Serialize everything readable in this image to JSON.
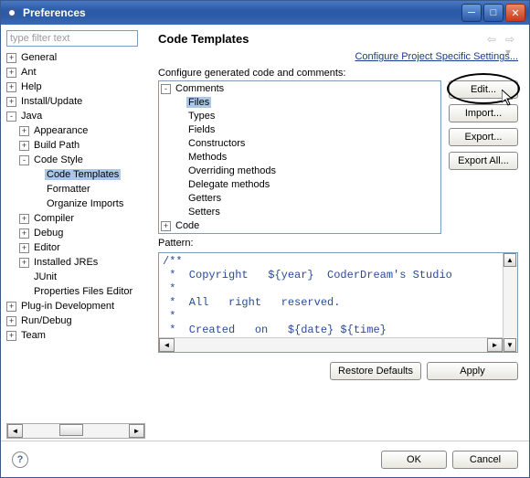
{
  "window": {
    "title": "Preferences"
  },
  "sidebar": {
    "filter_text": "type filter text",
    "tree": [
      {
        "label": "General",
        "tw": "+",
        "depth": 0
      },
      {
        "label": "Ant",
        "tw": "+",
        "depth": 0
      },
      {
        "label": "Help",
        "tw": "+",
        "depth": 0
      },
      {
        "label": "Install/Update",
        "tw": "+",
        "depth": 0
      },
      {
        "label": "Java",
        "tw": "-",
        "depth": 0
      },
      {
        "label": "Appearance",
        "tw": "+",
        "depth": 1
      },
      {
        "label": "Build Path",
        "tw": "+",
        "depth": 1
      },
      {
        "label": "Code Style",
        "tw": "-",
        "depth": 1
      },
      {
        "label": "Code Templates",
        "tw": "",
        "depth": 2,
        "selected": true
      },
      {
        "label": "Formatter",
        "tw": "",
        "depth": 2
      },
      {
        "label": "Organize Imports",
        "tw": "",
        "depth": 2
      },
      {
        "label": "Compiler",
        "tw": "+",
        "depth": 1
      },
      {
        "label": "Debug",
        "tw": "+",
        "depth": 1
      },
      {
        "label": "Editor",
        "tw": "+",
        "depth": 1
      },
      {
        "label": "Installed JREs",
        "tw": "+",
        "depth": 1
      },
      {
        "label": "JUnit",
        "tw": "",
        "depth": 1
      },
      {
        "label": "Properties Files Editor",
        "tw": "",
        "depth": 1
      },
      {
        "label": "Plug-in Development",
        "tw": "+",
        "depth": 0
      },
      {
        "label": "Run/Debug",
        "tw": "+",
        "depth": 0
      },
      {
        "label": "Team",
        "tw": "+",
        "depth": 0
      }
    ]
  },
  "main": {
    "title": "Code Templates",
    "project_link": "Configure Project Specific Settings...",
    "configure_label": "Configure generated code and comments:",
    "templates_tree": [
      {
        "label": "Comments",
        "tw": "-",
        "depth": 0
      },
      {
        "label": "Files",
        "tw": "",
        "depth": 1,
        "selected": true
      },
      {
        "label": "Types",
        "tw": "",
        "depth": 1
      },
      {
        "label": "Fields",
        "tw": "",
        "depth": 1
      },
      {
        "label": "Constructors",
        "tw": "",
        "depth": 1
      },
      {
        "label": "Methods",
        "tw": "",
        "depth": 1
      },
      {
        "label": "Overriding methods",
        "tw": "",
        "depth": 1
      },
      {
        "label": "Delegate methods",
        "tw": "",
        "depth": 1
      },
      {
        "label": "Getters",
        "tw": "",
        "depth": 1
      },
      {
        "label": "Setters",
        "tw": "",
        "depth": 1
      },
      {
        "label": "Code",
        "tw": "+",
        "depth": 0
      }
    ],
    "buttons": {
      "edit": "Edit...",
      "import": "Import...",
      "export": "Export...",
      "export_all": "Export All..."
    },
    "pattern_label": "Pattern:",
    "pattern_code": "/**\n *  Copyright   ${year}  CoderDream's Studio\n *\n *  All   right   reserved.\n *\n *  Created   on   ${date} ${time}\n */",
    "restore_label": "Restore Defaults",
    "apply_label": "Apply"
  },
  "footer": {
    "ok": "OK",
    "cancel": "Cancel"
  }
}
